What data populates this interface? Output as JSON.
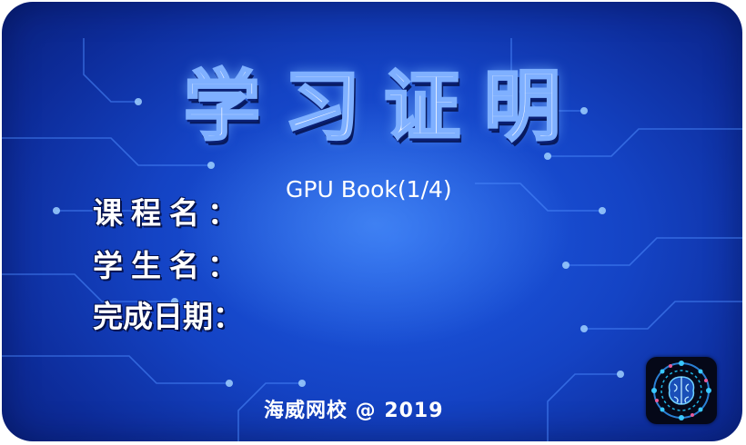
{
  "certificate": {
    "title": "学习证明",
    "course_name": "GPU Book(1/4)",
    "labels": {
      "course": "课程名：",
      "student": "学生名：",
      "completion_date": "完成日期："
    },
    "footer": "海威网校 @ 2019",
    "logo_icon": "brain-circuit-icon",
    "colors": {
      "background": "#1443c4",
      "glow": "#5aa0ff",
      "title_outline": "#7fb0ff",
      "text": "#ffffff"
    }
  }
}
